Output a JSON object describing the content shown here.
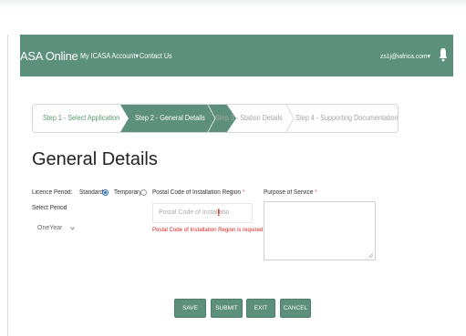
{
  "navbar": {
    "brand": "ASA Online",
    "account_menu": "My ICASA Account",
    "contact": "Contact Us",
    "user_email": "zs1j@iafrica.com",
    "caret": "▾",
    "bell_icon": "bell-icon",
    "color": "#5c8f7c"
  },
  "steps": [
    {
      "label": "Step 1 - Select Application",
      "state": "completed"
    },
    {
      "label": "Step 2 - General Details",
      "state": "active"
    },
    {
      "label": "Step 3 - Station Details",
      "state": "inactive"
    },
    {
      "label": "Step 4 - Supporting Documentation",
      "state": "inactive"
    }
  ],
  "page_title": "General Details",
  "form": {
    "licence_period": {
      "label": "Licence Period:",
      "options": [
        {
          "label": "Standard",
          "checked": true
        },
        {
          "label": "Temporary",
          "checked": false
        }
      ]
    },
    "select_period": {
      "label": "Select Period",
      "value": "OneYear"
    },
    "postal_code": {
      "label": "Postal Code of Installation Region",
      "required_mark": "*",
      "placeholder": "Postal Code of Installatio",
      "error": "Postal Code of Installation Region is required",
      "error_icon": "!"
    },
    "purpose": {
      "label": "Purpose of Service",
      "required_mark": "*",
      "value": ""
    }
  },
  "buttons": {
    "save": "SAVE",
    "submit": "SUBMIT",
    "exit": "EXIT",
    "cancel": "CANCEL"
  },
  "colors": {
    "accent": "#5c8f7c",
    "error": "#e02020",
    "step_done_text": "#5a9a6c"
  }
}
